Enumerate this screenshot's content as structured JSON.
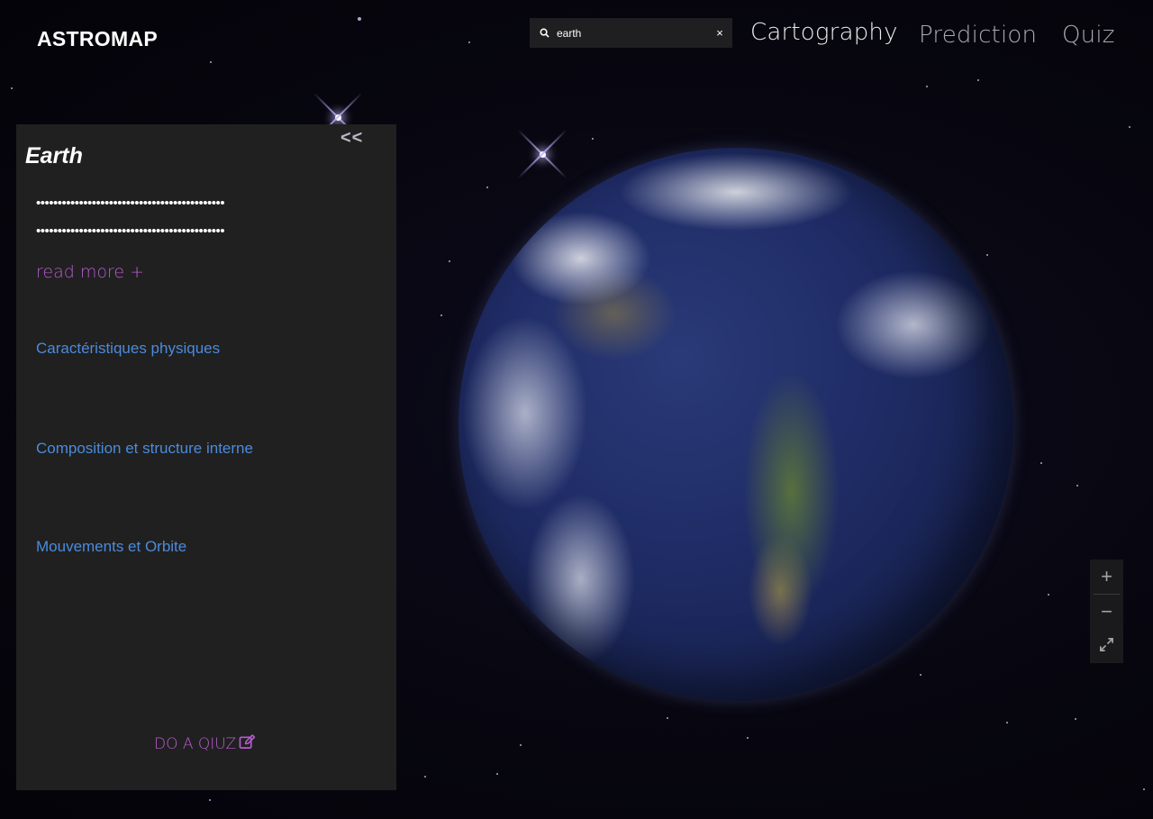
{
  "header": {
    "logo": "ASTROMAP",
    "search": {
      "value": "earth",
      "clear_label": "×"
    },
    "nav": {
      "cartography": "Cartography",
      "prediction": "Prediction",
      "quiz": "Quiz"
    }
  },
  "panel": {
    "collapse_label": "<<",
    "title": "Earth",
    "description_lines": [
      "••••••••••••••••••••••••••••••••••••••••••••",
      "••••••••••••••••••••••••••••••••••••••••••••"
    ],
    "read_more": "read more +",
    "sections": [
      "Caractéristiques physiques",
      "Composition et structure interne",
      "Mouvements et Orbite"
    ],
    "quiz_button": "DO A QIUZ"
  },
  "map_controls": {
    "zoom_in": "+",
    "zoom_out": "−",
    "fullscreen_icon": "expand-icon"
  },
  "colors": {
    "accent_purple": "#b65ccc",
    "link_blue": "#4b8bdc",
    "panel_bg": "#202020"
  }
}
